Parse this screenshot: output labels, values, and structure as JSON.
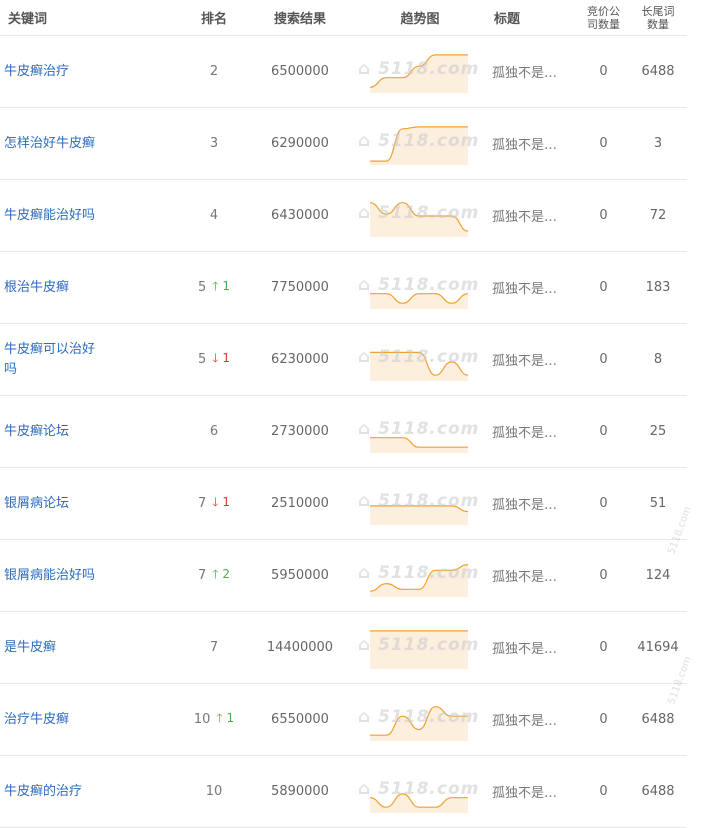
{
  "header": {
    "keyword": "关键词",
    "rank": "排名",
    "results": "搜索结果",
    "trend": "趋势图",
    "title": "标题",
    "bid_companies": "竞价公司数量",
    "longtail": "长尾词数量"
  },
  "watermark": "5118.com",
  "colors": {
    "keyword_link": "#2a6cbf",
    "trend_line": "#f0a030",
    "trend_fill": "#fdecd8",
    "up": "#4caf50",
    "down": "#e53935"
  },
  "rows": [
    {
      "keyword": "牛皮癣治疗",
      "rank": "2",
      "change": "",
      "dir": "",
      "results": "6500000",
      "title": "孤独不是…",
      "bid": "0",
      "longtail": "6488",
      "trend": [
        0.1,
        0.35,
        0.35,
        0.65,
        0.95,
        0.95,
        0.95
      ]
    },
    {
      "keyword": "怎样治好牛皮癣",
      "rank": "3",
      "change": "",
      "dir": "",
      "results": "6290000",
      "title": "孤独不是…",
      "bid": "0",
      "longtail": "3",
      "trend": [
        0.05,
        0.05,
        0.9,
        0.95,
        0.95,
        0.95,
        0.95
      ]
    },
    {
      "keyword": "牛皮癣能治好吗",
      "rank": "4",
      "change": "",
      "dir": "",
      "results": "6430000",
      "title": "孤独不是…",
      "bid": "0",
      "longtail": "72",
      "trend": [
        0.85,
        0.55,
        0.85,
        0.5,
        0.5,
        0.5,
        0.1
      ]
    },
    {
      "keyword": "根治牛皮癣",
      "rank": "5",
      "change": "1",
      "dir": "up",
      "results": "7750000",
      "title": "孤独不是…",
      "bid": "0",
      "longtail": "183",
      "trend": [
        0.35,
        0.35,
        0.1,
        0.35,
        0.35,
        0.1,
        0.35
      ]
    },
    {
      "keyword": "牛皮癣可以治好吗",
      "rank": "5",
      "change": "1",
      "dir": "down",
      "results": "6230000",
      "title": "孤独不是…",
      "bid": "0",
      "longtail": "8",
      "trend": [
        0.7,
        0.7,
        0.7,
        0.7,
        0.1,
        0.45,
        0.1
      ]
    },
    {
      "keyword": "牛皮癣论坛",
      "rank": "6",
      "change": "",
      "dir": "",
      "results": "2730000",
      "title": "孤独不是…",
      "bid": "0",
      "longtail": "25",
      "trend": [
        0.35,
        0.35,
        0.35,
        0.1,
        0.1,
        0.1,
        0.1
      ]
    },
    {
      "keyword": "银屑病论坛",
      "rank": "7",
      "change": "1",
      "dir": "down",
      "results": "2510000",
      "title": "孤独不是…",
      "bid": "0",
      "longtail": "51",
      "trend": [
        0.45,
        0.45,
        0.45,
        0.45,
        0.45,
        0.45,
        0.3
      ]
    },
    {
      "keyword": "银屑病能治好吗",
      "rank": "7",
      "change": "2",
      "dir": "up",
      "results": "5950000",
      "title": "孤独不是…",
      "bid": "0",
      "longtail": "124",
      "trend": [
        0.1,
        0.3,
        0.15,
        0.15,
        0.65,
        0.65,
        0.8
      ]
    },
    {
      "keyword": "是牛皮癣",
      "rank": "7",
      "change": "",
      "dir": "",
      "results": "14400000",
      "title": "孤独不是…",
      "bid": "0",
      "longtail": "41694",
      "trend": [
        0.95,
        0.95,
        0.95,
        0.95,
        0.95,
        0.95,
        0.95
      ]
    },
    {
      "keyword": "治疗牛皮癣",
      "rank": "10",
      "change": "1",
      "dir": "up",
      "results": "6550000",
      "title": "孤独不是…",
      "bid": "0",
      "longtail": "6488",
      "trend": [
        0.1,
        0.1,
        0.6,
        0.25,
        0.85,
        0.6,
        0.6
      ]
    },
    {
      "keyword": "牛皮癣的治疗",
      "rank": "10",
      "change": "",
      "dir": "",
      "results": "5890000",
      "title": "孤独不是…",
      "bid": "0",
      "longtail": "6488",
      "trend": [
        0.35,
        0.1,
        0.45,
        0.1,
        0.1,
        0.35,
        0.35
      ]
    }
  ]
}
